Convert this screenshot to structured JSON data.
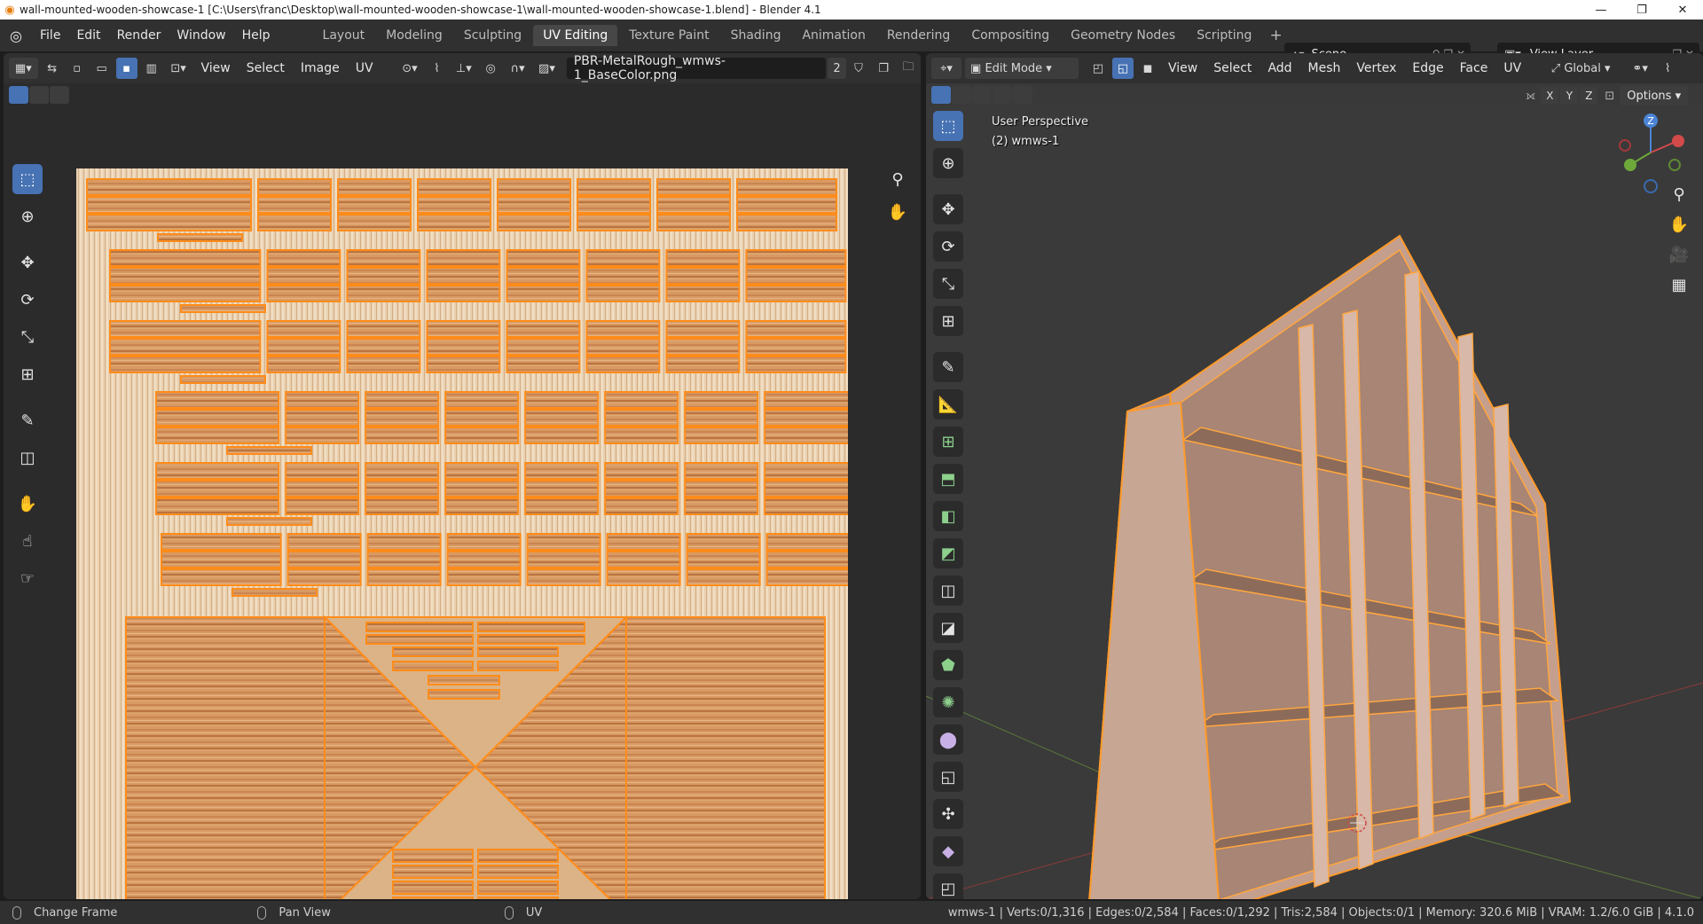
{
  "window": {
    "title": "wall-mounted-wooden-showcase-1 [C:\\Users\\franc\\Desktop\\wall-mounted-wooden-showcase-1\\wall-mounted-wooden-showcase-1.blend] - Blender 4.1",
    "controls": [
      "—",
      "❐",
      "✕"
    ]
  },
  "menubar": {
    "menus": [
      "File",
      "Edit",
      "Render",
      "Window",
      "Help"
    ],
    "workspaces": [
      "Layout",
      "Modeling",
      "Sculpting",
      "UV Editing",
      "Texture Paint",
      "Shading",
      "Animation",
      "Rendering",
      "Compositing",
      "Geometry Nodes",
      "Scripting"
    ],
    "active_workspace": "UV Editing",
    "add_symbol": "+",
    "scene": "Scene",
    "view_layer": "View Layer"
  },
  "uv_editor": {
    "menus": [
      "View",
      "Select",
      "Image",
      "UV"
    ],
    "image_name": "PBR-MetalRough_wmws-1_BaseColor.png",
    "image_users": "2",
    "tools": [
      "select-box-icon",
      "cursor-icon",
      "move-icon",
      "rotate-icon",
      "scale-icon",
      "transform-icon",
      "annotate-icon",
      "rip-region-icon",
      "grab-icon",
      "relax-icon",
      "pinch-icon"
    ]
  },
  "viewport": {
    "mode": "Edit Mode",
    "menus": [
      "View",
      "Select",
      "Add",
      "Mesh",
      "Vertex",
      "Edge",
      "Face",
      "UV"
    ],
    "orientation": "Global",
    "options_label": "Options",
    "axis_labels": [
      "X",
      "Y",
      "Z"
    ],
    "perspective_label": "User Perspective",
    "object_label": "(2) wmws-1",
    "gizmo_z": "Z"
  },
  "statusbar": {
    "left_action": "Change Frame",
    "middle_action": "Pan View",
    "right_action": "UV",
    "stats": "wmws-1 | Verts:0/1,316 | Edges:0/2,584 | Faces:0/1,292 | Tris:2,584 | Objects:0/1 | Memory: 320.6 MiB | VRAM: 1.2/6.0 GiB | 4.1.0"
  },
  "colors": {
    "accent": "#4772b3",
    "selection": "#ff8c1a",
    "wood": "#d89a63"
  }
}
